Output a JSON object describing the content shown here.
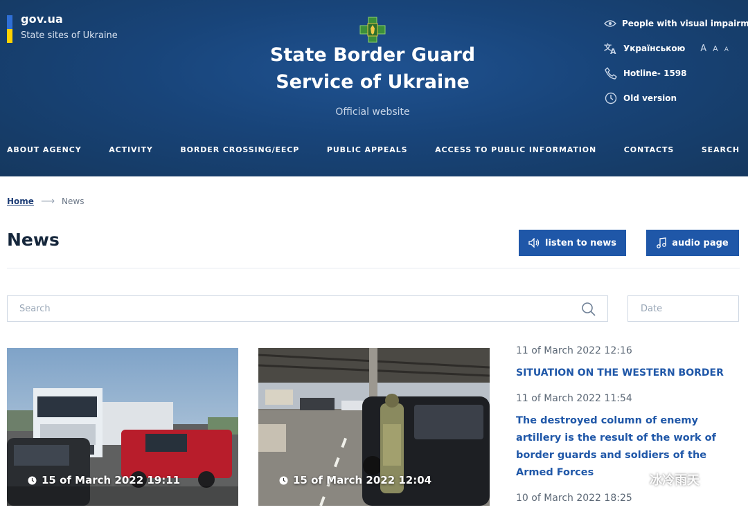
{
  "header": {
    "gov_title": "gov.ua",
    "gov_subtitle": "State sites of Ukraine",
    "site_title_line1": "State Border Guard",
    "site_title_line2": "Service of Ukraine",
    "site_subtitle": "Official website",
    "tools": {
      "visual": "People with visual impairment",
      "language": "Українською",
      "font_large": "A",
      "font_medium": "A",
      "font_small": "A",
      "hotline": "Hotline- 1598",
      "old_version": "Old version"
    },
    "colors": {
      "background": "#184479",
      "gov_blue": "#2f6fd6",
      "gov_yellow": "#ffd200",
      "accent": "#1f57a8"
    }
  },
  "nav": [
    "ABOUT AGENCY",
    "ACTIVITY",
    "BORDER CROSSING/EECP",
    "PUBLIC APPEALS",
    "ACCESS TO PUBLIC INFORMATION",
    "CONTACTS",
    "SEARCH"
  ],
  "breadcrumb": {
    "home": "Home",
    "current": "News"
  },
  "page": {
    "title": "News",
    "listen_button": "listen to news",
    "audio_button": "audio page"
  },
  "search": {
    "placeholder": "Search",
    "date_placeholder": "Date"
  },
  "cards": [
    {
      "date": "15 of March 2022 19:11"
    },
    {
      "date": "15 of March 2022 12:04"
    }
  ],
  "news_list": [
    {
      "date": "11 of March 2022 12:16",
      "title": "SITUATION ON THE WESTERN BORDER"
    },
    {
      "date": "11 of March 2022 11:54",
      "title": "The destroyed column of enemy artillery is the result of the work of border guards and soldiers of the Armed Forces"
    },
    {
      "date": "10 of March 2022 18:25"
    }
  ],
  "watermark": "冰冷雨天"
}
